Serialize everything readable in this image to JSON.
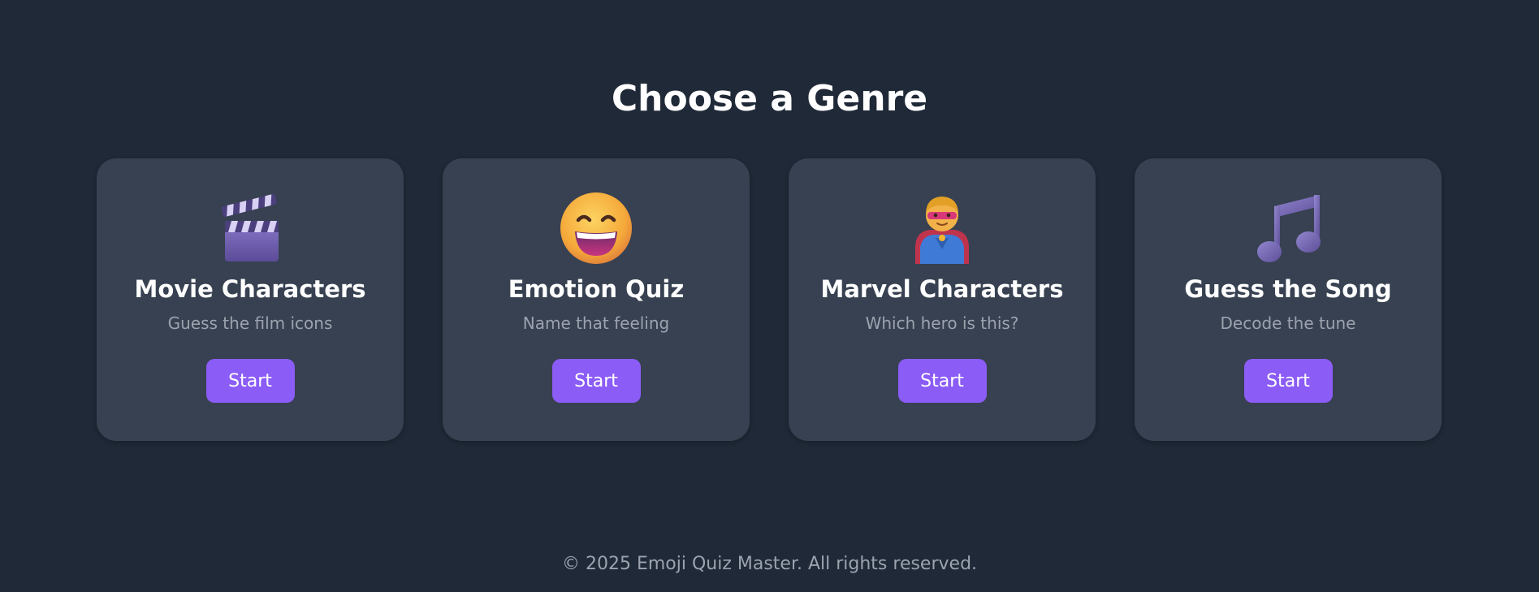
{
  "page": {
    "title": "Choose a Genre"
  },
  "genres": [
    {
      "icon": "clapper-board-icon",
      "title": "Movie Characters",
      "description": "Guess the film icons",
      "button_label": "Start"
    },
    {
      "icon": "grinning-face-icon",
      "title": "Emotion Quiz",
      "description": "Name that feeling",
      "button_label": "Start"
    },
    {
      "icon": "superhero-icon",
      "title": "Marvel Characters",
      "description": "Which hero is this?",
      "button_label": "Start"
    },
    {
      "icon": "musical-note-icon",
      "title": "Guess the Song",
      "description": "Decode the tune",
      "button_label": "Start"
    }
  ],
  "footer": {
    "text": "© 2025 Emoji Quiz Master. All rights reserved."
  },
  "colors": {
    "background": "#1f2937",
    "card": "#374151",
    "accent": "#8b5cf6",
    "muted_text": "#9ca3af"
  }
}
